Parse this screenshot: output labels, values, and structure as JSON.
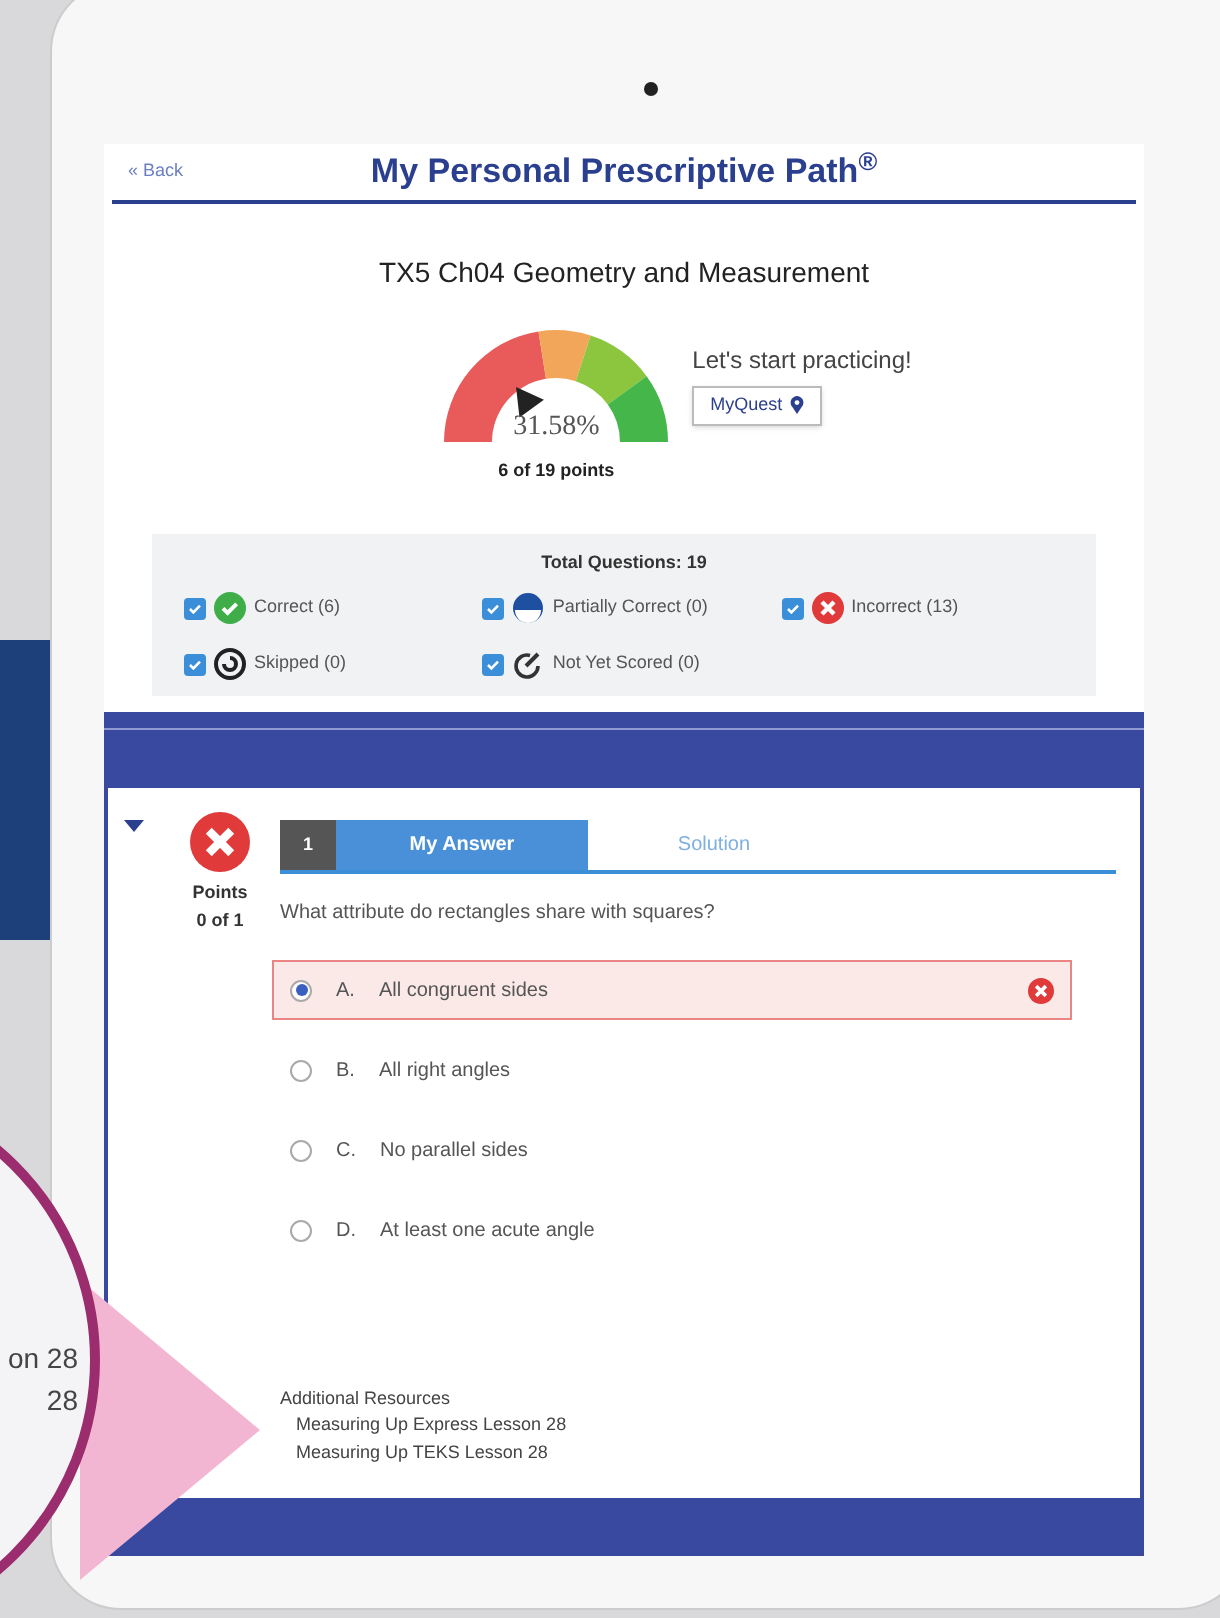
{
  "header": {
    "back": "« Back",
    "title": "My Personal Prescriptive Path$^{®}$"
  },
  "assessment": {
    "title": "TX5 Ch04 Geometry and Measurement",
    "gauge": {
      "reading": "31.58%"
    },
    "points": "6 of 19 points",
    "message": "Let's start practicing!",
    "button": "MyQuest"
  },
  "legend": {
    "total": "Total Questions: 19",
    "items": [
      {
        "kind": "correct",
        "label": "Correct (6)",
        "checked": true
      },
      {
        "kind": "partial",
        "label": "Partially Correct (0)",
        "checked": true
      },
      {
        "kind": "incorrect",
        "label": "Incorrect (13)",
        "checked": true
      },
      {
        "kind": "skipped",
        "label": "Skipped (0)",
        "checked": true
      },
      {
        "kind": "unscored",
        "label": "Not Yet Scored (0)",
        "checked": true
      }
    ]
  },
  "question": {
    "expanded": true,
    "correct": false,
    "points_label": "Points",
    "points": "0 of 1",
    "number": "1",
    "tabs": [
      {
        "label": "My Answer",
        "selected": true
      },
      {
        "label": "Solution",
        "selected": false
      }
    ],
    "prompt": "What attribute do rectangles share with squares?",
    "options": [
      {
        "letter": "A.",
        "text": "All congruent sides",
        "selected": true,
        "wrong": true
      },
      {
        "letter": "B.",
        "text": "All right angles",
        "selected": false,
        "wrong": false
      },
      {
        "letter": "C.",
        "text": "No parallel sides",
        "selected": false,
        "wrong": false
      },
      {
        "letter": "D.",
        "text": "At least one acute angle",
        "selected": false,
        "wrong": false
      }
    ],
    "resources": {
      "title": "Additional Resources",
      "links": [
        "Measuring Up Express Lesson 28",
        "Measuring Up TEKS Lesson 28"
      ]
    }
  },
  "magnifier": {
    "lines": [
      "on 28",
      "28"
    ]
  }
}
